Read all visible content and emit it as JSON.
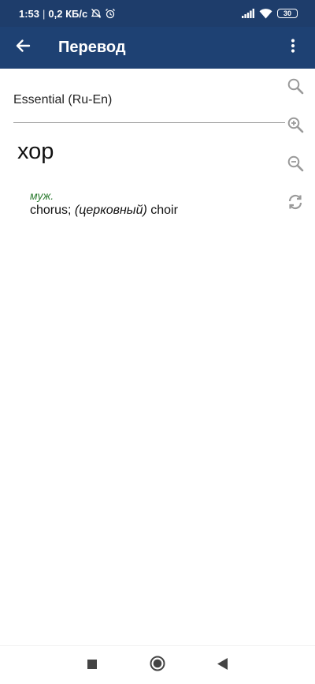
{
  "status": {
    "time": "1:53",
    "separator": "|",
    "speed": "0,2 КБ/с",
    "battery": "30"
  },
  "app_bar": {
    "title": "Перевод"
  },
  "entry": {
    "dictionary": "Essential (Ru-En)",
    "headword": "хор",
    "grammar": "муж.",
    "translation_part1": "chorus; ",
    "translation_note": "(церковный)",
    "translation_part2": " choir"
  },
  "icons": {
    "back": "arrow-left-icon",
    "menu": "more-vertical-icon",
    "search": "search-icon",
    "zoom_in": "zoom-in-icon",
    "zoom_out": "zoom-out-icon",
    "refresh": "refresh-icon"
  },
  "colors": {
    "status_bar": "#1e3d6b",
    "app_bar": "#1e4173",
    "grammar_label": "#2e7d32",
    "tool_icons": "#9a9a9a"
  }
}
